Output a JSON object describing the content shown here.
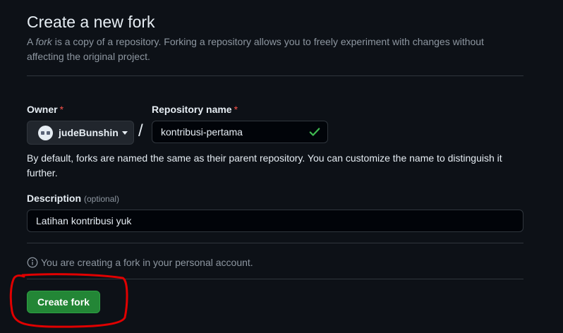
{
  "header": {
    "title": "Create a new fork",
    "subtitle_prefix": "A ",
    "subtitle_em": "fork",
    "subtitle_rest": " is a copy of a repository. Forking a repository allows you to freely experiment with changes without affecting the original project."
  },
  "owner": {
    "label": "Owner",
    "required_mark": "*",
    "value": "judeBunshin",
    "icon": "chevron-down-icon"
  },
  "separator": "/",
  "repository": {
    "label": "Repository name",
    "required_mark": "*",
    "value": "kontribusi-pertama",
    "status_icon": "check-icon",
    "status_color": "#3fb950"
  },
  "hint": "By default, forks are named the same as their parent repository. You can customize the name to distinguish it further.",
  "description": {
    "label": "Description",
    "optional": "(optional)",
    "value": "Latihan kontribusi yuk"
  },
  "info": {
    "icon": "info-icon",
    "text": "You are creating a fork in your personal account."
  },
  "actions": {
    "create_label": "Create fork",
    "primary_color": "#238636"
  },
  "annotation": {
    "color": "#e00000",
    "shape": "hand-drawn circle around create button"
  }
}
